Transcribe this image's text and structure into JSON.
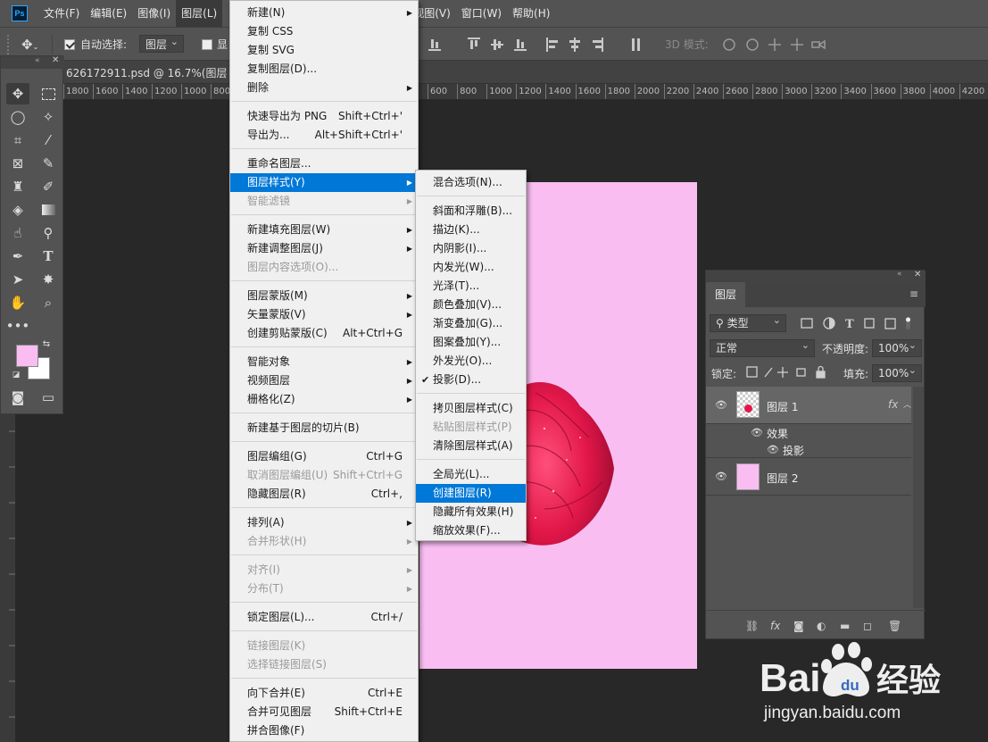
{
  "menubar": {
    "logo": "Ps",
    "items": [
      "文件(F)",
      "编辑(E)",
      "图像(I)",
      "图层(L)",
      "视图(V)",
      "窗口(W)",
      "帮助(H)"
    ]
  },
  "options": {
    "auto_select_label": "自动选择:",
    "auto_select_value": "图层",
    "show_transform_label": "显",
    "mode3d_label": "3D 模式:"
  },
  "document": {
    "tab_label": "626172911.psd @ 16.7%(图层 1,"
  },
  "ruler": {
    "left_ticks": [
      "1800",
      "1600",
      "1400",
      "1200",
      "1000",
      "800"
    ],
    "right_ticks": [
      "600",
      "800",
      "1000",
      "1200",
      "1400",
      "1600",
      "1800",
      "2000",
      "2200",
      "2400",
      "2600",
      "2800",
      "3000",
      "3200",
      "3400",
      "3600",
      "3800",
      "4000",
      "4200"
    ]
  },
  "colors": {
    "foreground": "#f9bdf2",
    "background": "#ffffff",
    "canvas": "#f9bdf2",
    "highlight": "#0078d7"
  },
  "layer_menu": {
    "items": [
      {
        "label": "新建(N)",
        "sub": true
      },
      {
        "label": "复制 CSS"
      },
      {
        "label": "复制 SVG"
      },
      {
        "label": "复制图层(D)..."
      },
      {
        "label": "删除",
        "sub": true
      },
      {
        "sep": true
      },
      {
        "label": "快速导出为 PNG",
        "shortcut": "Shift+Ctrl+'"
      },
      {
        "label": "导出为...",
        "shortcut": "Alt+Shift+Ctrl+'"
      },
      {
        "sep": true
      },
      {
        "label": "重命名图层..."
      },
      {
        "label": "图层样式(Y)",
        "sub": true,
        "highlight": true
      },
      {
        "label": "智能滤镜",
        "sub": true,
        "disabled": true
      },
      {
        "sep": true
      },
      {
        "label": "新建填充图层(W)",
        "sub": true
      },
      {
        "label": "新建调整图层(J)",
        "sub": true
      },
      {
        "label": "图层内容选项(O)...",
        "disabled": true
      },
      {
        "sep": true
      },
      {
        "label": "图层蒙版(M)",
        "sub": true
      },
      {
        "label": "矢量蒙版(V)",
        "sub": true
      },
      {
        "label": "创建剪贴蒙版(C)",
        "shortcut": "Alt+Ctrl+G"
      },
      {
        "sep": true
      },
      {
        "label": "智能对象",
        "sub": true
      },
      {
        "label": "视频图层",
        "sub": true
      },
      {
        "label": "栅格化(Z)",
        "sub": true
      },
      {
        "sep": true
      },
      {
        "label": "新建基于图层的切片(B)"
      },
      {
        "sep": true
      },
      {
        "label": "图层编组(G)",
        "shortcut": "Ctrl+G"
      },
      {
        "label": "取消图层编组(U)",
        "shortcut": "Shift+Ctrl+G",
        "disabled": true
      },
      {
        "label": "隐藏图层(R)",
        "shortcut": "Ctrl+,"
      },
      {
        "sep": true
      },
      {
        "label": "排列(A)",
        "sub": true
      },
      {
        "label": "合并形状(H)",
        "sub": true,
        "disabled": true
      },
      {
        "sep": true
      },
      {
        "label": "对齐(I)",
        "sub": true,
        "disabled": true
      },
      {
        "label": "分布(T)",
        "sub": true,
        "disabled": true
      },
      {
        "sep": true
      },
      {
        "label": "锁定图层(L)...",
        "shortcut": "Ctrl+/"
      },
      {
        "sep": true
      },
      {
        "label": "链接图层(K)",
        "disabled": true
      },
      {
        "label": "选择链接图层(S)",
        "disabled": true
      },
      {
        "sep": true
      },
      {
        "label": "向下合并(E)",
        "shortcut": "Ctrl+E"
      },
      {
        "label": "合并可见图层",
        "shortcut": "Shift+Ctrl+E"
      },
      {
        "label": "拼合图像(F)"
      }
    ]
  },
  "style_submenu": {
    "items": [
      {
        "label": "混合选项(N)..."
      },
      {
        "sep": true
      },
      {
        "label": "斜面和浮雕(B)..."
      },
      {
        "label": "描边(K)..."
      },
      {
        "label": "内阴影(I)..."
      },
      {
        "label": "内发光(W)..."
      },
      {
        "label": "光泽(T)..."
      },
      {
        "label": "颜色叠加(V)..."
      },
      {
        "label": "渐变叠加(G)..."
      },
      {
        "label": "图案叠加(Y)..."
      },
      {
        "label": "外发光(O)..."
      },
      {
        "label": "投影(D)...",
        "checked": true
      },
      {
        "sep": true
      },
      {
        "label": "拷贝图层样式(C)"
      },
      {
        "label": "粘贴图层样式(P)",
        "disabled": true
      },
      {
        "label": "清除图层样式(A)"
      },
      {
        "sep": true
      },
      {
        "label": "全局光(L)..."
      },
      {
        "label": "创建图层(R)",
        "highlight": true
      },
      {
        "label": "隐藏所有效果(H)"
      },
      {
        "label": "缩放效果(F)..."
      }
    ]
  },
  "layers_panel": {
    "tab": "图层",
    "filter_value": "类型",
    "blend_mode": "正常",
    "opacity_label": "不透明度:",
    "opacity_value": "100%",
    "lock_label": "锁定:",
    "fill_label": "填充:",
    "fill_value": "100%",
    "layers": [
      {
        "name": "图层 1",
        "fx": "fx",
        "effects_label": "效果",
        "effect": "投影"
      },
      {
        "name": "图层 2"
      }
    ]
  },
  "watermark": {
    "brand_left": "Bai",
    "brand_right": "经验",
    "url": "jingyan.baidu.com"
  }
}
